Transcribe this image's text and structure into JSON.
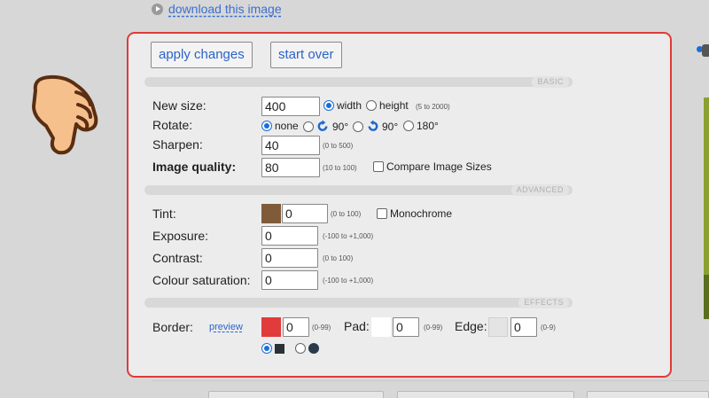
{
  "header": {
    "download_label": "download this image"
  },
  "toolbar": {
    "apply_label": "apply changes",
    "start_over_label": "start over"
  },
  "sections": {
    "basic": "BASIC",
    "advanced": "ADVANCED",
    "effects": "EFFECTS"
  },
  "basic": {
    "new_size": {
      "label": "New size:",
      "value": "400",
      "opt_width": "width",
      "opt_height": "height",
      "hint": "(5 to 2000)"
    },
    "rotate": {
      "label": "Rotate:",
      "opt_none": "none",
      "opt_90cw": "90°",
      "opt_90ccw": "90°",
      "opt_180": "180°"
    },
    "sharpen": {
      "label": "Sharpen:",
      "value": "40",
      "hint": "(0 to 500)"
    },
    "quality": {
      "label": "Image quality:",
      "value": "80",
      "hint": "(10 to 100)",
      "compare_label": "Compare Image Sizes"
    }
  },
  "advanced": {
    "tint": {
      "label": "Tint:",
      "value": "0",
      "hint": "(0 to 100)",
      "monochrome_label": "Monochrome",
      "color": "#7e5c3a"
    },
    "exposure": {
      "label": "Exposure:",
      "value": "0",
      "hint": "(-100 to +1,000)"
    },
    "contrast": {
      "label": "Contrast:",
      "value": "0",
      "hint": "(0 to 100)"
    },
    "saturation": {
      "label": "Colour saturation:",
      "value": "0",
      "hint": "(-100 to +1,000)"
    }
  },
  "effects": {
    "border": {
      "label": "Border:",
      "preview_label": "preview",
      "value": "0",
      "hint": "(0-99)",
      "color": "#e13b3b"
    },
    "pad": {
      "label": "Pad:",
      "value": "0",
      "hint": "(0-99)",
      "color": "#ffffff"
    },
    "edge": {
      "label": "Edge:",
      "value": "0",
      "hint": "(0-9)",
      "color": "#e4e4e4"
    },
    "shape_selected": "square"
  },
  "colors": {
    "accent": "#2b63c9",
    "highlight_border": "#e03a3a",
    "radio_on": "#1a6ed8"
  }
}
